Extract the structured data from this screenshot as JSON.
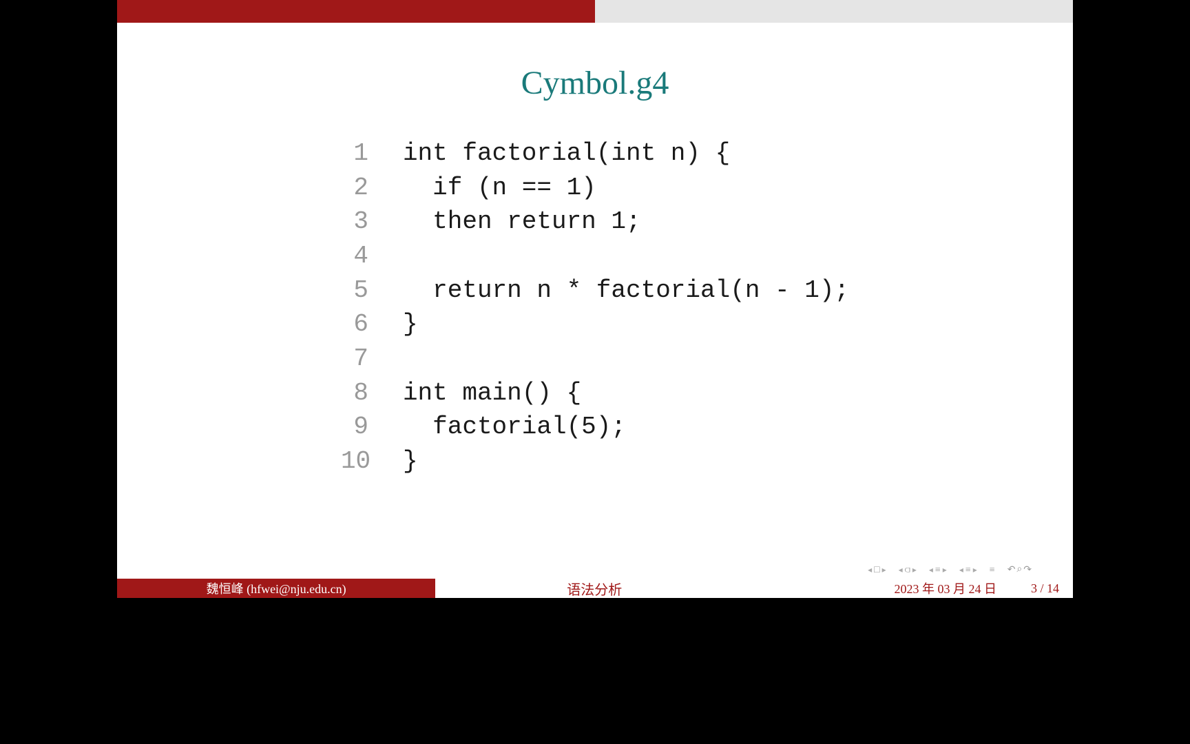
{
  "slide": {
    "title": "Cymbol.g4",
    "code_lines": [
      {
        "n": "1",
        "c": "int factorial(int n) {"
      },
      {
        "n": "2",
        "c": "  if (n == 1)"
      },
      {
        "n": "3",
        "c": "  then return 1;"
      },
      {
        "n": "4",
        "c": ""
      },
      {
        "n": "5",
        "c": "  return n * factorial(n - 1);"
      },
      {
        "n": "6",
        "c": "}"
      },
      {
        "n": "7",
        "c": ""
      },
      {
        "n": "8",
        "c": "int main() {"
      },
      {
        "n": "9",
        "c": "  factorial(5);"
      },
      {
        "n": "10",
        "c": "}"
      }
    ]
  },
  "footer": {
    "author": "魏恒峰  (hfwei@nju.edu.cn)",
    "title": "语法分析",
    "date": "2023 年 03 月 24 日",
    "page": "3 / 14"
  },
  "nav": {
    "frame": "□",
    "subsection": "⫏",
    "section_prev": "≡",
    "section_next": "≡",
    "presentation": "≡",
    "undo": "↶",
    "search": "⌕",
    "redo": "↷"
  }
}
